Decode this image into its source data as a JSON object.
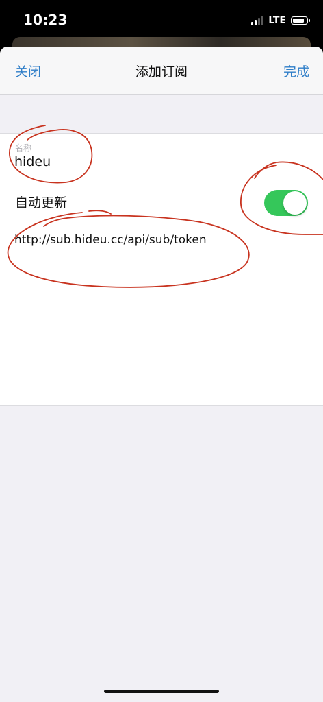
{
  "status_bar": {
    "time": "10:23",
    "network": "LTE",
    "signal_bars_active": 2,
    "signal_bars_total": 4,
    "battery_level": 0.85
  },
  "nav": {
    "close_label": "关闭",
    "title": "添加订阅",
    "done_label": "完成"
  },
  "form": {
    "name_label": "名称",
    "name_value": "hideu",
    "auto_update_label": "自动更新",
    "auto_update_on": true,
    "url_value": "http://sub.hideu.cc/api/sub/token"
  },
  "colors": {
    "accent": "#2f7ec8",
    "toggle_on": "#35c75a",
    "annotation": "#c8331f",
    "sheet_background": "#f1f0f5"
  },
  "icons": [
    "cellular-signal-icon",
    "battery-icon"
  ]
}
